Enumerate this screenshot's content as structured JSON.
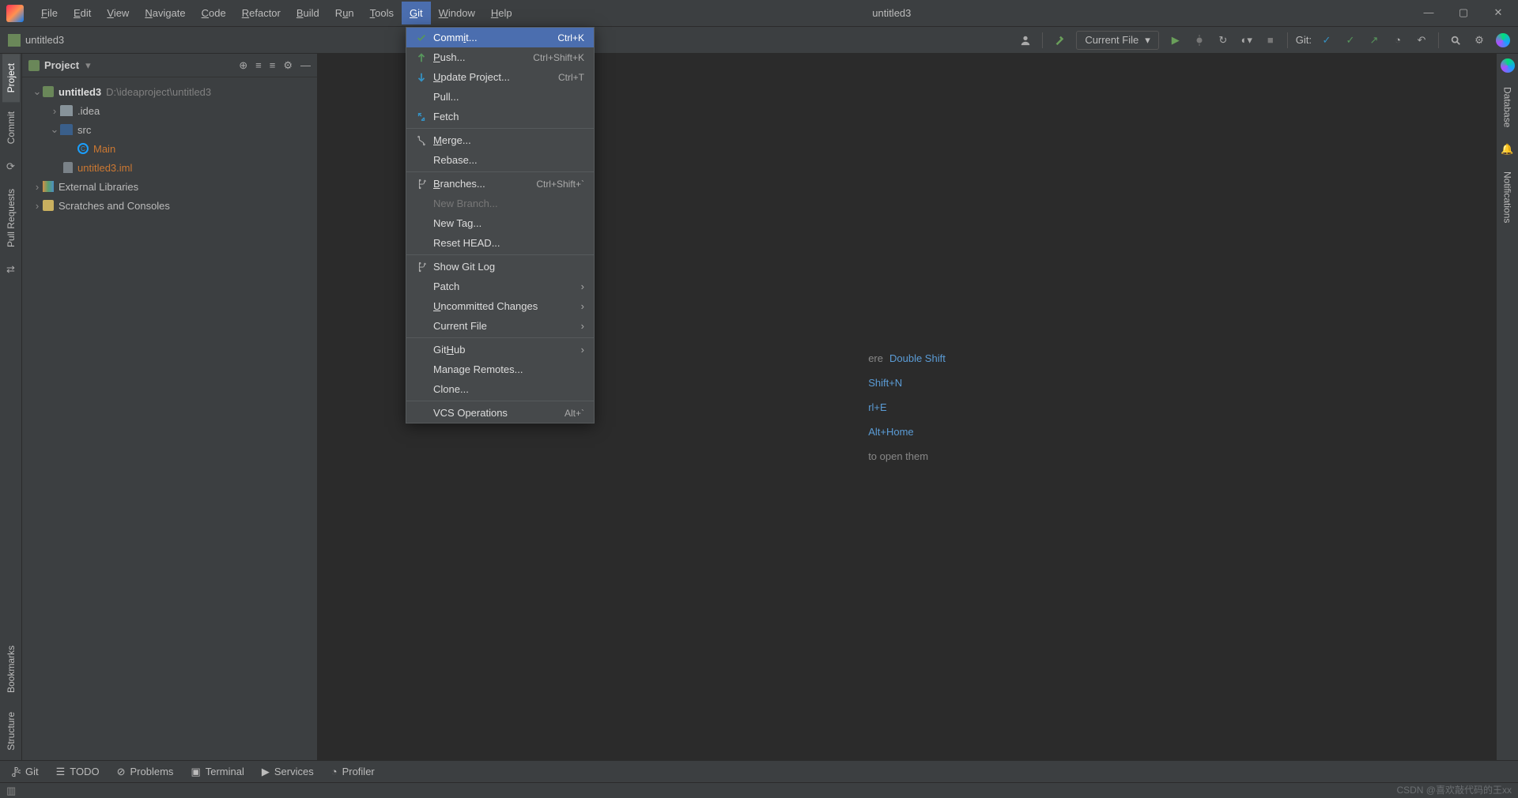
{
  "document_title": "untitled3",
  "menubar": {
    "items": [
      {
        "label": "File",
        "u": "F"
      },
      {
        "label": "Edit",
        "u": "E"
      },
      {
        "label": "View",
        "u": "V"
      },
      {
        "label": "Navigate",
        "u": "N"
      },
      {
        "label": "Code",
        "u": "C"
      },
      {
        "label": "Refactor",
        "u": "R"
      },
      {
        "label": "Build",
        "u": "B"
      },
      {
        "label": "Run",
        "u": "u"
      },
      {
        "label": "Tools",
        "u": "T"
      },
      {
        "label": "Git",
        "u": "G",
        "active": true
      },
      {
        "label": "Window",
        "u": "W"
      },
      {
        "label": "Help",
        "u": "H"
      }
    ]
  },
  "breadcrumb": {
    "project": "untitled3"
  },
  "toolbar": {
    "run_config": "Current File",
    "git_label": "Git:"
  },
  "left_strip": [
    "Project",
    "Commit",
    "Pull Requests",
    "Bookmarks",
    "Structure"
  ],
  "right_strip": [
    "Database",
    "Notifications"
  ],
  "project_panel": {
    "title": "Project",
    "tree": {
      "root": {
        "name": "untitled3",
        "path": "D:\\ideaproject\\untitled3"
      },
      "idea": ".idea",
      "src": "src",
      "main": "Main",
      "iml": "untitled3.iml",
      "ext": "External Libraries",
      "scratch": "Scratches and Consoles"
    }
  },
  "git_menu": {
    "items": [
      {
        "icon": "check-green",
        "label": "Commit...",
        "u": "i",
        "shortcut": "Ctrl+K",
        "hi": true
      },
      {
        "icon": "arrow-up-green",
        "label": "Push...",
        "u": "P",
        "shortcut": "Ctrl+Shift+K"
      },
      {
        "icon": "arrow-down-blue",
        "label": "Update Project...",
        "u": "U",
        "shortcut": "Ctrl+T"
      },
      {
        "icon": "",
        "label": "Pull..."
      },
      {
        "icon": "fetch",
        "label": "Fetch"
      },
      {
        "sep": true
      },
      {
        "icon": "merge",
        "label": "Merge...",
        "u": "M"
      },
      {
        "icon": "",
        "label": "Rebase..."
      },
      {
        "sep": true
      },
      {
        "icon": "branch",
        "label": "Branches...",
        "u": "B",
        "shortcut": "Ctrl+Shift+`"
      },
      {
        "icon": "",
        "label": "New Branch...",
        "disabled": true
      },
      {
        "icon": "",
        "label": "New Tag..."
      },
      {
        "icon": "",
        "label": "Reset HEAD..."
      },
      {
        "sep": true
      },
      {
        "icon": "branch",
        "label": "Show Git Log"
      },
      {
        "icon": "",
        "label": "Patch",
        "sub": true
      },
      {
        "icon": "",
        "label": "Uncommitted Changes",
        "u": "U",
        "sub": true
      },
      {
        "icon": "",
        "label": "Current File",
        "sub": true
      },
      {
        "sep": true
      },
      {
        "icon": "",
        "label": "GitHub",
        "u": "H",
        "sub": true
      },
      {
        "icon": "",
        "label": "Manage Remotes..."
      },
      {
        "icon": "",
        "label": "Clone..."
      },
      {
        "sep": true
      },
      {
        "icon": "",
        "label": "VCS Operations",
        "shortcut": "Alt+`"
      }
    ]
  },
  "welcome": {
    "r1_text": "ere",
    "r1_kb": "Double Shift",
    "r2_kb": "Shift+N",
    "r3_kb": "rl+E",
    "r4_kb": "Alt+Home",
    "r5_text": "to open them"
  },
  "status_bar": {
    "git": "Git",
    "todo": "TODO",
    "problems": "Problems",
    "terminal": "Terminal",
    "services": "Services",
    "profiler": "Profiler"
  },
  "watermark": "CSDN @喜欢敲代码的王xx"
}
